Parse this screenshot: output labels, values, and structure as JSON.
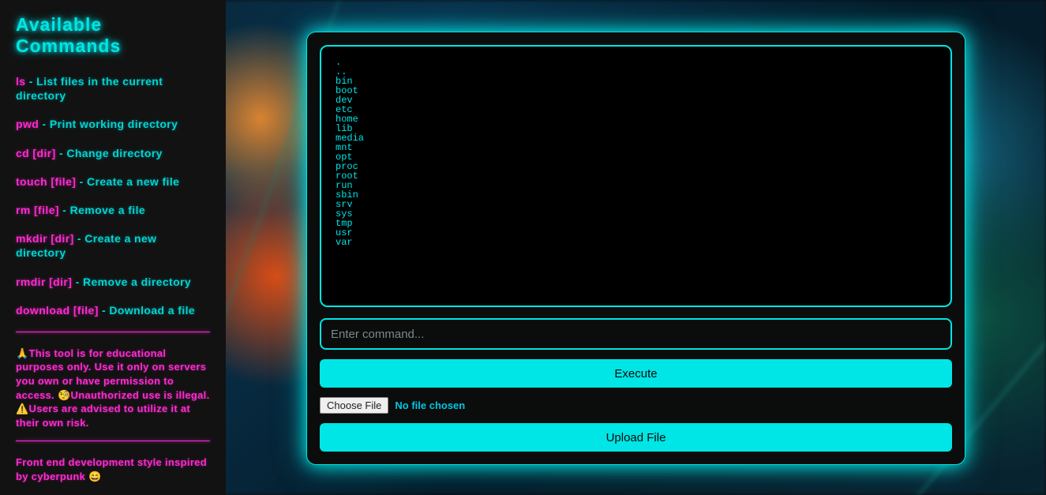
{
  "colors": {
    "accent": "#00e5e5",
    "magenta": "#ff2ad2"
  },
  "sidebar": {
    "title": "Available Commands",
    "commands": [
      {
        "name": "ls",
        "desc": "List files in the current directory"
      },
      {
        "name": "pwd",
        "desc": "Print working directory"
      },
      {
        "name": "cd [dir]",
        "desc": "Change directory"
      },
      {
        "name": "touch [file]",
        "desc": "Create a new file"
      },
      {
        "name": "rm [file]",
        "desc": "Remove a file"
      },
      {
        "name": "mkdir [dir]",
        "desc": "Create a new directory"
      },
      {
        "name": "rmdir [dir]",
        "desc": "Remove a directory"
      },
      {
        "name": "download [file]",
        "desc": "Download a file"
      }
    ],
    "disclaimer_parts": [
      "🙏",
      "This tool is for educational purposes only. Use it only on servers you own or have permission to access. ",
      "🧐",
      "Unauthorized use is illegal. ",
      "⚠️",
      "Users are advised to utilize it at their own risk."
    ],
    "credit": "Front end development style inspired by cyberpunk ",
    "credit_emoji": "😄"
  },
  "terminal": {
    "output_lines": [
      ".",
      "..",
      "bin",
      "boot",
      "dev",
      "etc",
      "home",
      "lib",
      "media",
      "mnt",
      "opt",
      "proc",
      "root",
      "run",
      "sbin",
      "srv",
      "sys",
      "tmp",
      "usr",
      "var"
    ],
    "input_placeholder": "Enter command...",
    "input_value": "",
    "execute_label": "Execute",
    "choose_file_label": "Choose File",
    "file_status": "No file chosen",
    "upload_label": "Upload File"
  }
}
